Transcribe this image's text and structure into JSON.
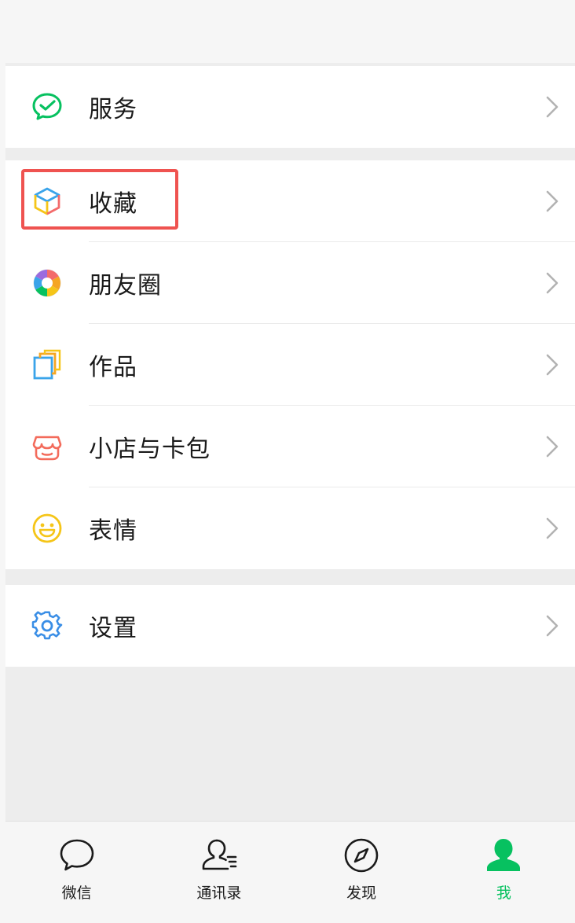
{
  "groups": [
    {
      "items": [
        {
          "label": "服务",
          "icon": "service-icon"
        }
      ]
    },
    {
      "items": [
        {
          "label": "收藏",
          "icon": "favorites-icon"
        },
        {
          "label": "朋友圈",
          "icon": "moments-icon"
        },
        {
          "label": "作品",
          "icon": "works-icon"
        },
        {
          "label": "小店与卡包",
          "icon": "shop-cards-icon"
        },
        {
          "label": "表情",
          "icon": "stickers-icon"
        }
      ]
    },
    {
      "items": [
        {
          "label": "设置",
          "icon": "settings-icon"
        }
      ]
    }
  ],
  "tabbar": {
    "tabs": [
      {
        "label": "微信",
        "icon": "chat-icon"
      },
      {
        "label": "通讯录",
        "icon": "contacts-icon"
      },
      {
        "label": "发现",
        "icon": "discover-icon"
      },
      {
        "label": "我",
        "icon": "me-icon",
        "active": true
      }
    ]
  },
  "colors": {
    "accent": "#07c160",
    "highlight_border": "#ef5350",
    "background": "#ededed",
    "row_background": "#ffffff"
  }
}
